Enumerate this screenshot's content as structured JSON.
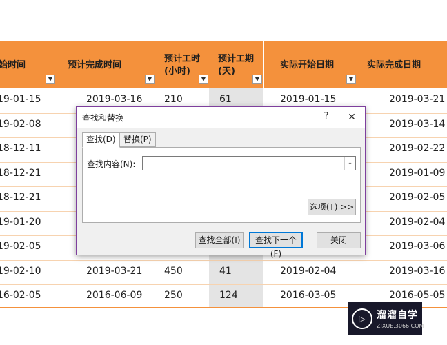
{
  "sheet": {
    "headers": [
      {
        "lines": [
          "始时间"
        ]
      },
      {
        "lines": [
          "预计完成时间"
        ]
      },
      {
        "lines": [
          "预计工时",
          "(小时)"
        ]
      },
      {
        "lines": [
          "预计工期",
          "(天)"
        ]
      },
      {
        "lines": [
          "实际开始日期"
        ]
      },
      {
        "lines": [
          "实际完成日期"
        ]
      }
    ],
    "filter_icon": "filter-dropdown-icon",
    "filter_glyph": "▼",
    "rows": [
      [
        "19-01-15",
        "2019-03-16",
        "210",
        "61",
        "2019-01-15",
        "2019-03-21"
      ],
      [
        "19-02-08",
        "",
        "",
        "",
        "",
        "2019-03-14"
      ],
      [
        "18-12-11",
        "",
        "",
        "",
        "",
        "2019-02-22"
      ],
      [
        "18-12-21",
        "",
        "",
        "",
        "",
        "2019-01-09"
      ],
      [
        "18-12-21",
        "",
        "",
        "",
        "",
        "2019-02-05"
      ],
      [
        "19-01-20",
        "",
        "",
        "",
        "",
        "2019-02-04"
      ],
      [
        "19-02-05",
        "",
        "",
        "",
        "",
        "2019-03-06"
      ],
      [
        "19-02-10",
        "2019-03-21",
        "450",
        "41",
        "2019-02-04",
        "2019-03-16"
      ],
      [
        "16-02-05",
        "2016-06-09",
        "250",
        "124",
        "2016-03-05",
        "2016-05-05"
      ]
    ],
    "colors": {
      "header": "#f4913c",
      "shaded_column": "#e4e4e4"
    }
  },
  "dialog": {
    "title": "查找和替换",
    "help_glyph": "?",
    "close_glyph": "✕",
    "tabs": [
      {
        "label": "查找(D)",
        "active": true
      },
      {
        "label": "替换(P)",
        "active": false
      }
    ],
    "find_label": "查找内容(N):",
    "find_value": "",
    "dropdown_glyph": "⌄",
    "options_button": "选项(T) >>",
    "find_all_button": "查找全部(I)",
    "find_next_button": "查找下一个(F)",
    "close_button": "关闭",
    "colors": {
      "border": "#7e3f9d",
      "default_button_border": "#0078d7"
    }
  },
  "watermark": {
    "logo_glyph": "▷",
    "name": "溜溜自学",
    "url": "ZIXUE.3066.COM"
  }
}
